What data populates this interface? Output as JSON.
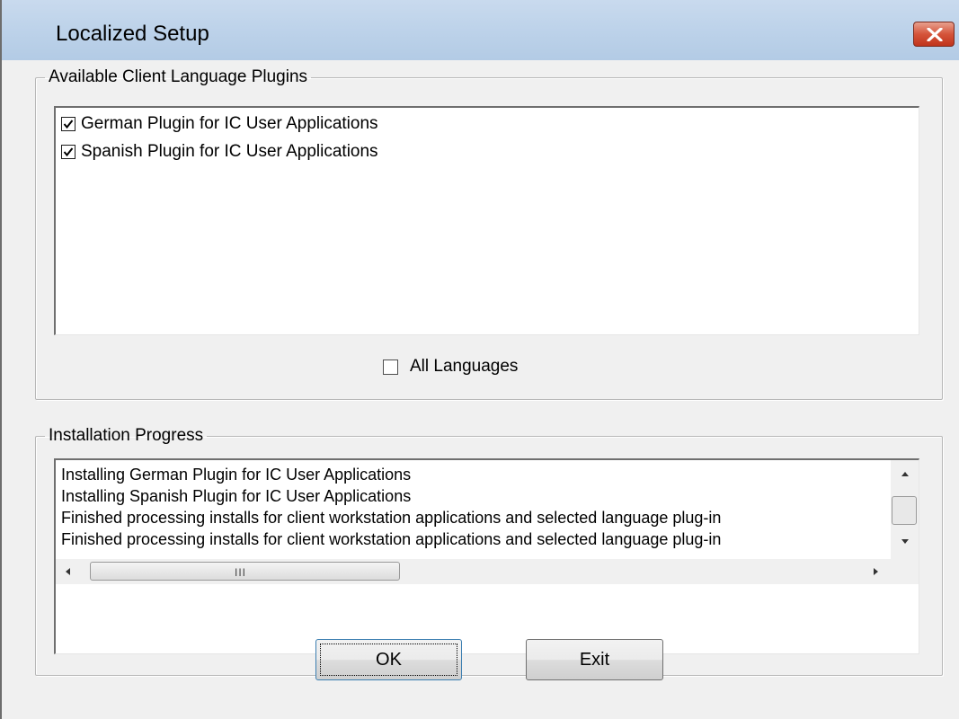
{
  "window": {
    "title": "Localized Setup"
  },
  "plugins_group": {
    "legend": "Available Client Language Plugins",
    "items": [
      {
        "label": "German Plugin for IC User Applications",
        "checked": true
      },
      {
        "label": "Spanish Plugin for IC User Applications",
        "checked": true
      }
    ],
    "all_languages_label": "All Languages",
    "all_languages_checked": false
  },
  "progress_group": {
    "legend": "Installation Progress",
    "lines": [
      "Installing  German Plugin for IC User Applications",
      "Installing  Spanish Plugin for IC User Applications",
      "Finished processing installs for client workstation applications and selected language plug-in",
      "Finished processing installs for client workstation applications and selected language plug-in"
    ],
    "hscroll_grip": "III"
  },
  "buttons": {
    "ok_label": "OK",
    "exit_label": "Exit"
  },
  "colors": {
    "title_bar": "#bed3ea",
    "close_button": "#d5543a",
    "dialog_background": "#f0f0f0"
  }
}
